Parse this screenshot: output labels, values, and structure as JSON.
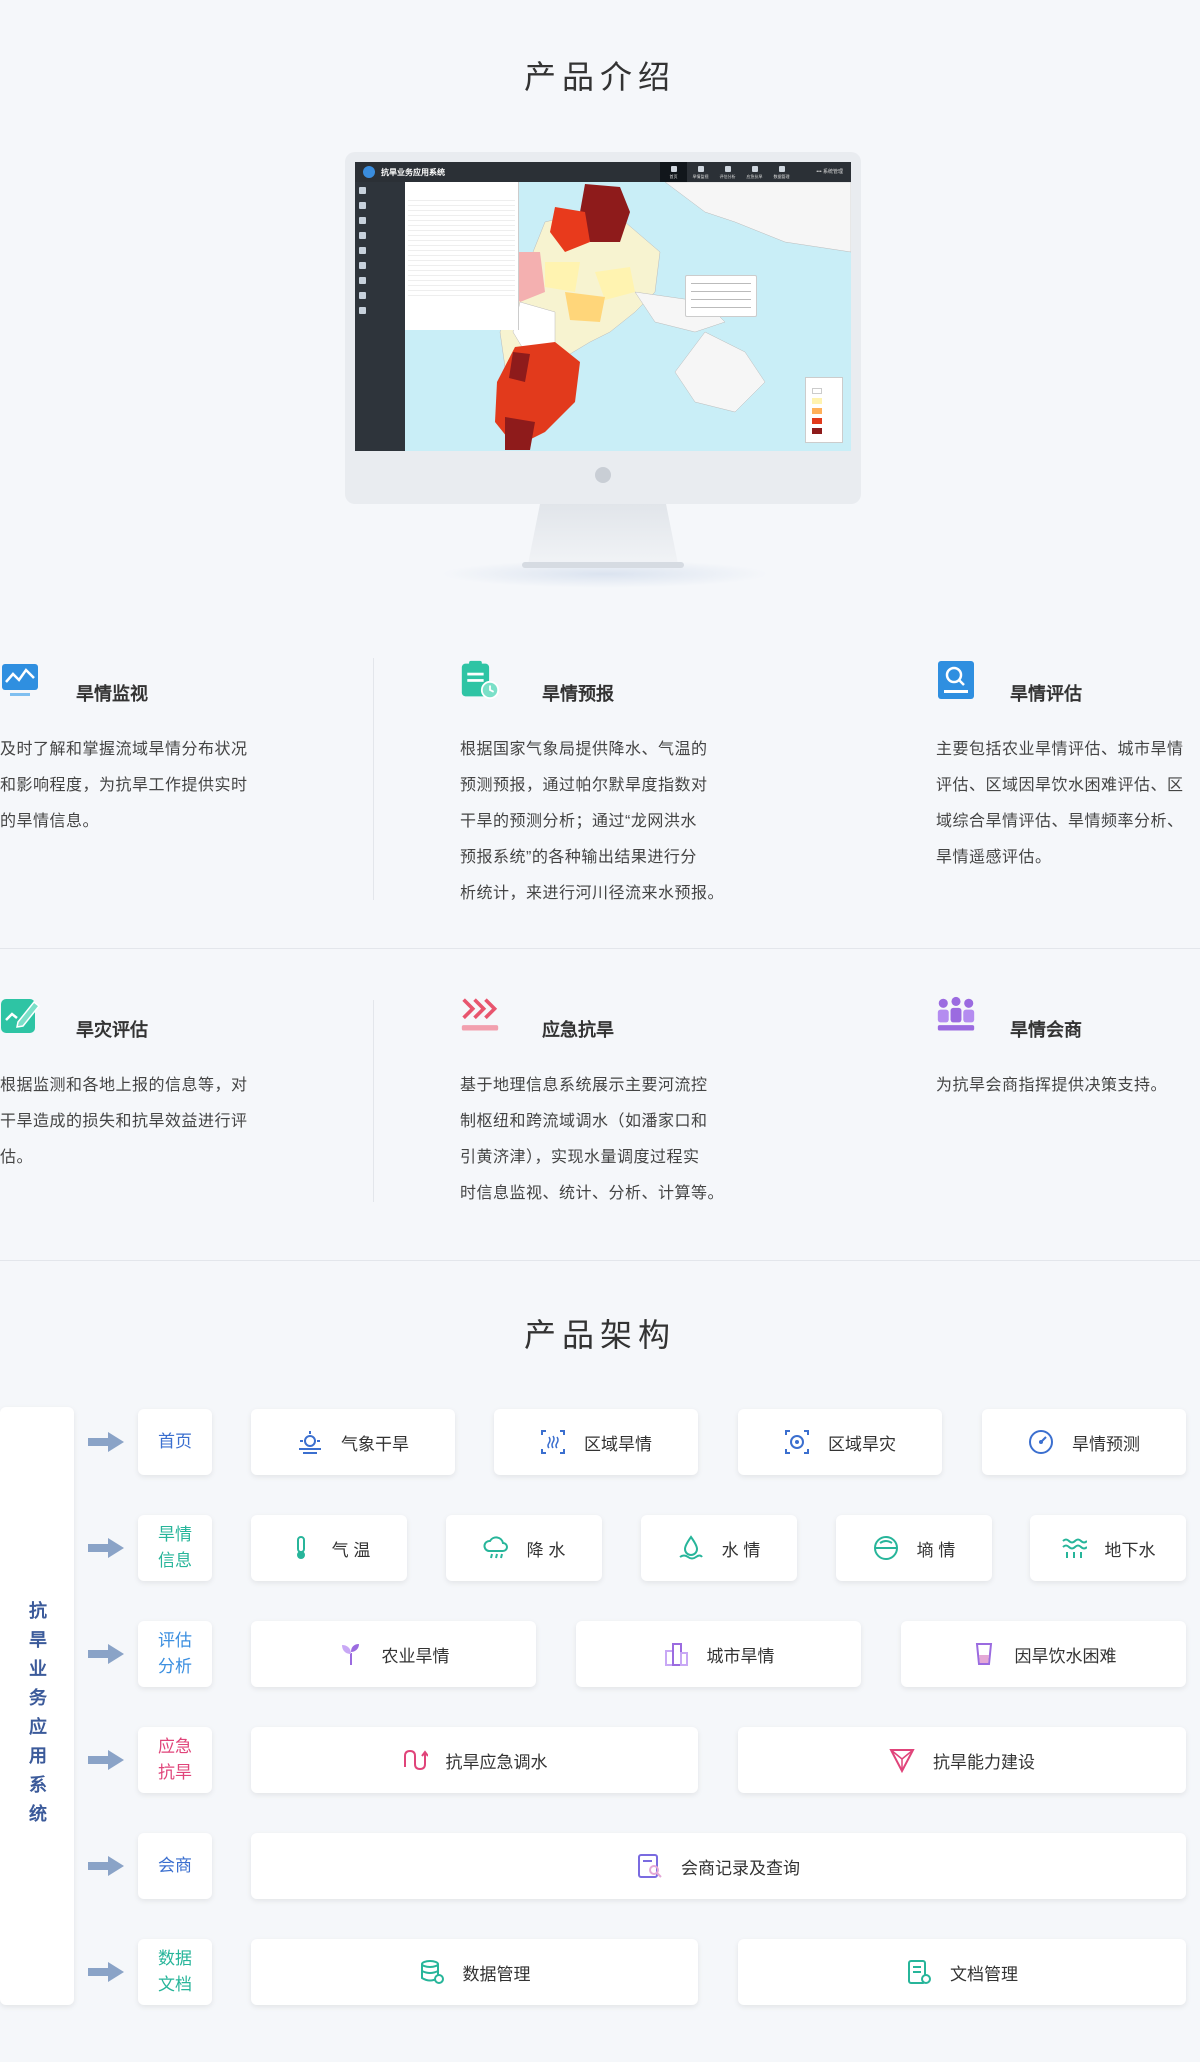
{
  "intro": {
    "title": "产品介绍",
    "screenshot": {
      "app_title": "抗旱业务应用系统",
      "nav": [
        "首页",
        "旱情监视",
        "评估分析",
        "应急抗旱",
        "数据管理"
      ],
      "user": "••• 系统管理"
    }
  },
  "features": [
    {
      "title": "旱情监视",
      "icon": "monitor-chart-icon",
      "color": "#2f8fe0",
      "lines": [
        "及时了解和掌握流域旱情分布状况",
        "和影响程度，为抗旱工作提供实时",
        "的旱情信息。"
      ]
    },
    {
      "title": "旱情预报",
      "icon": "clipboard-clock-icon",
      "color": "#2ec4a4",
      "lines": [
        "根据国家气象局提供降水、气温的",
        "预测预报，通过帕尔默旱度指数对",
        "干旱的预测分析；通过“龙网洪水",
        "预报系统”的各种输出结果进行分",
        "析统计，来进行河川径流来水预报。"
      ]
    },
    {
      "title": "旱情评估",
      "icon": "document-search-icon",
      "color": "#2f8fe0",
      "lines": [
        "主要包括农业旱情评估、城市旱情",
        "评估、区域因旱饮水困难评估、区",
        "域综合旱情评估、旱情频率分析、",
        "旱情遥感评估。"
      ]
    },
    {
      "title": "旱灾评估",
      "icon": "edit-pen-icon",
      "color": "#2ec4a4",
      "lines": [
        "根据监测和各地上报的信息等，对",
        "干旱造成的损失和抗旱效益进行评",
        "估。"
      ]
    },
    {
      "title": "应急抗旱",
      "icon": "heat-waves-icon",
      "color": "#e8556e",
      "lines": [
        "基于地理信息系统展示主要河流控",
        "制枢纽和跨流域调水（如潘家口和",
        "引黄济津），实现水量调度过程实",
        "时信息监视、统计、分析、计算等。"
      ]
    },
    {
      "title": "旱情会商",
      "icon": "meeting-people-icon",
      "color": "#9b6be0",
      "lines": [
        "为抗旱会商指挥提供决策支持。"
      ]
    }
  ],
  "architecture": {
    "title": "产品架构",
    "root_label": "抗旱业务应用系统",
    "rows": [
      {
        "category": "首页",
        "cat_color": "#3b6fcf",
        "items": [
          {
            "label": "气象干旱",
            "icon": "sun-cloud-icon",
            "color": "#3b6fcf"
          },
          {
            "label": "区域旱情",
            "icon": "region-drought-icon",
            "color": "#3b6fcf"
          },
          {
            "label": "区域旱灾",
            "icon": "region-disaster-icon",
            "color": "#3b6fcf"
          },
          {
            "label": "旱情预测",
            "icon": "gauge-icon",
            "color": "#3b6fcf"
          }
        ]
      },
      {
        "category": "旱情信息",
        "cat_color": "#27b59a",
        "items": [
          {
            "label": "气 温",
            "icon": "thermometer-icon",
            "color": "#27b59a"
          },
          {
            "label": "降 水",
            "icon": "rain-cloud-icon",
            "color": "#27b59a"
          },
          {
            "label": "水 情",
            "icon": "water-drop-icon",
            "color": "#27b59a"
          },
          {
            "label": "墒 情",
            "icon": "soil-moisture-icon",
            "color": "#27b59a"
          },
          {
            "label": "地下水",
            "icon": "groundwater-icon",
            "color": "#27b59a"
          }
        ]
      },
      {
        "category": "评估分析",
        "cat_color": "#3b8fe0",
        "items": [
          {
            "label": "农业旱情",
            "icon": "sprout-icon",
            "color": "#9b6be0"
          },
          {
            "label": "城市旱情",
            "icon": "city-icon",
            "color": "#9b6be0"
          },
          {
            "label": "因旱饮水困难",
            "icon": "cup-icon",
            "color": "#9b6be0"
          }
        ]
      },
      {
        "category": "应急抗旱",
        "cat_color": "#e0447a",
        "items": [
          {
            "label": "抗旱应急调水",
            "icon": "water-transfer-icon",
            "color": "#e0447a"
          },
          {
            "label": "抗旱能力建设",
            "icon": "triangle-build-icon",
            "color": "#e0447a"
          }
        ]
      },
      {
        "category": "会商",
        "cat_color": "#3b6fcf",
        "items": [
          {
            "label": "会商记录及查询",
            "icon": "record-search-icon",
            "color": "#7a6be0"
          }
        ]
      },
      {
        "category": "数据文档",
        "cat_color": "#27b59a",
        "items": [
          {
            "label": "数据管理",
            "icon": "database-icon",
            "color": "#27b59a"
          },
          {
            "label": "文档管理",
            "icon": "document-manage-icon",
            "color": "#27b59a"
          }
        ]
      }
    ]
  }
}
